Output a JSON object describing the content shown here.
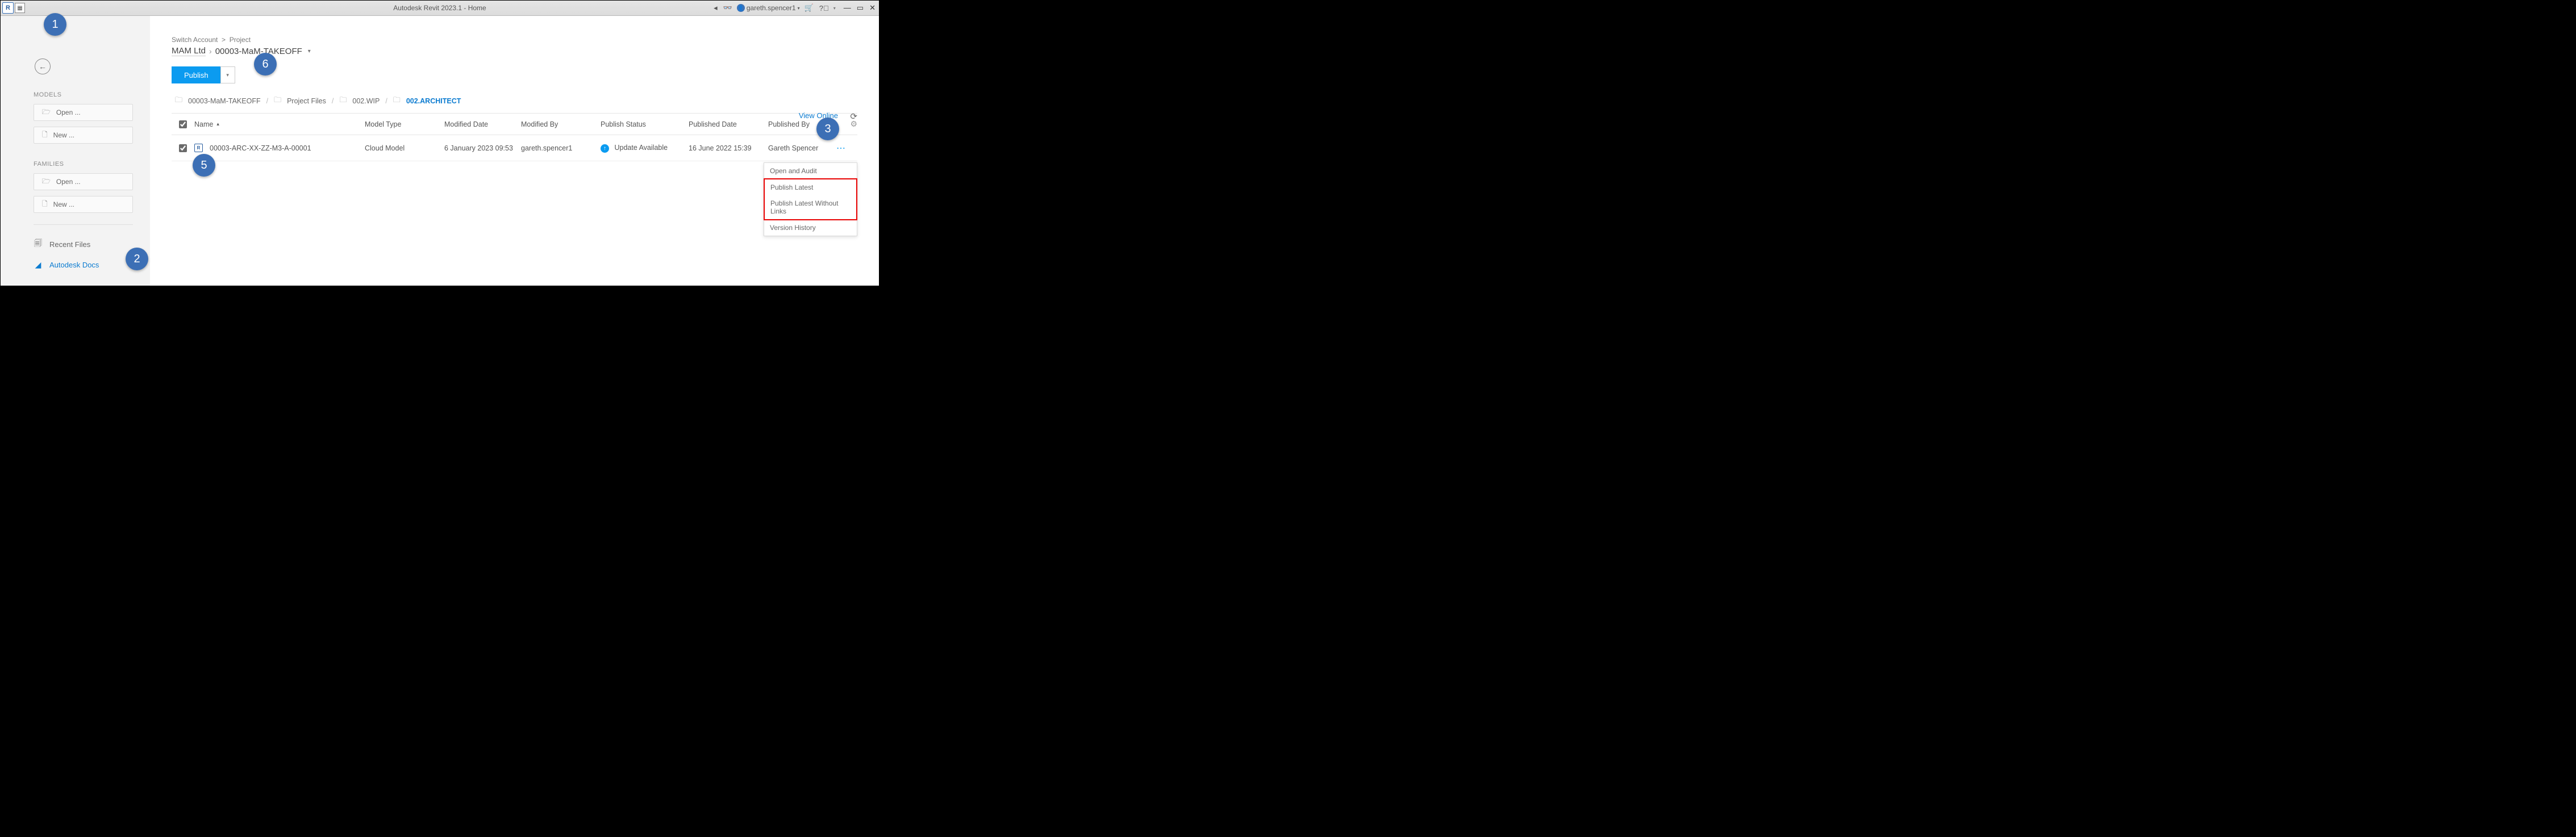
{
  "titlebar": {
    "title": "Autodesk Revit 2023.1 - Home",
    "user": "gareth.spencer1"
  },
  "sidebar": {
    "models_label": "MODELS",
    "families_label": "FAMILIES",
    "open_label": "Open ...",
    "new_label": "New ...",
    "recent_files": "Recent Files",
    "autodesk_docs": "Autodesk Docs"
  },
  "main": {
    "switch_account": "Switch Account",
    "project_label": "Project",
    "account_name": "MAM Ltd",
    "project_name": "00003-MaM-TAKEOFF",
    "publish_label": "Publish",
    "path": {
      "p1": "00003-MaM-TAKEOFF",
      "p2": "Project Files",
      "p3": "002.WIP",
      "p4": "002.ARCHITECT"
    },
    "view_online": "View Online",
    "headers": {
      "name": "Name",
      "type": "Model Type",
      "mdate": "Modified Date",
      "mby": "Modified By",
      "pstatus": "Publish Status",
      "pdate": "Published Date",
      "pby": "Published By"
    },
    "row": {
      "name": "00003-ARC-XX-ZZ-M3-A-00001",
      "type": "Cloud Model",
      "mdate": "6 January 2023 09:53",
      "mby": "gareth.spencer1",
      "pstatus": "Update Available",
      "pdate": "16 June 2022 15:39",
      "pby": "Gareth Spencer"
    },
    "ctx": {
      "open_audit": "Open and Audit",
      "pub_latest": "Publish Latest",
      "pub_latest_nolinks": "Publish Latest Without Links",
      "version_history": "Version History"
    }
  },
  "badges": {
    "b1": "1",
    "b2": "2",
    "b3": "3",
    "b5": "5",
    "b6": "6"
  }
}
